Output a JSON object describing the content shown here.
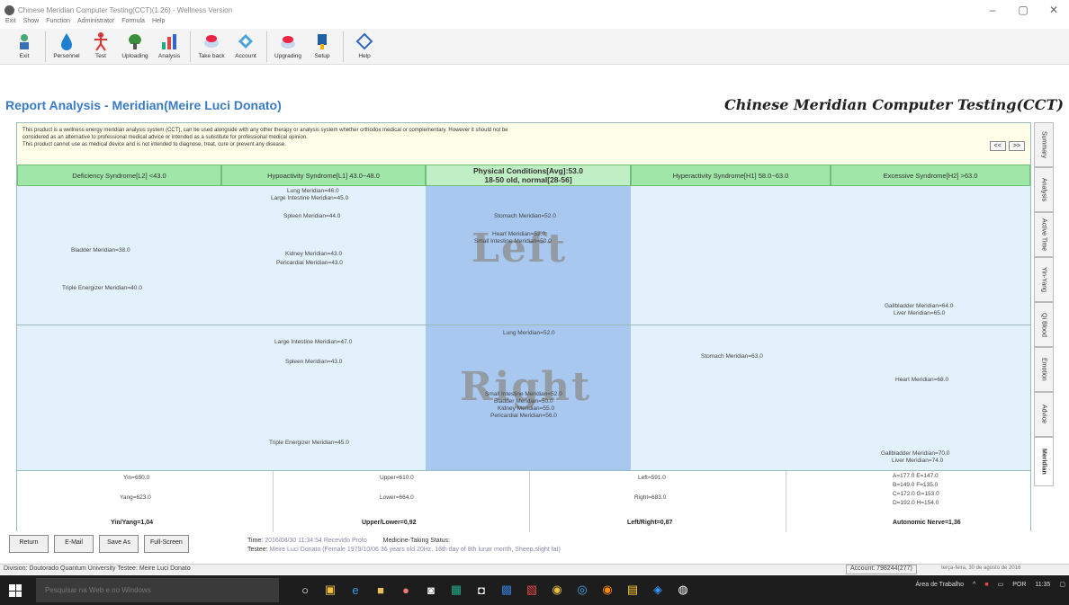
{
  "window": {
    "title": "Chinese Meridian Computer Testing(CCT)(1.26) - Wellness Version"
  },
  "menu": [
    "Exit",
    "Show",
    "Function",
    "Administrator",
    "Formula",
    "Help"
  ],
  "toolbar": [
    {
      "label": "Exit",
      "icon": "exit-icon"
    },
    {
      "label": "Personnel",
      "icon": "person-drop-icon"
    },
    {
      "label": "Test",
      "icon": "test-figure-icon"
    },
    {
      "label": "Uploading",
      "icon": "upload-icon"
    },
    {
      "label": "Analysis",
      "icon": "analysis-chart-icon"
    },
    {
      "label": "Take back",
      "icon": "takeback-icon"
    },
    {
      "label": "Account",
      "icon": "account-icon"
    },
    {
      "label": "Upgrading",
      "icon": "upgrade-icon"
    },
    {
      "label": "Setup",
      "icon": "setup-icon"
    },
    {
      "label": "Help",
      "icon": "help-icon"
    }
  ],
  "report": {
    "title": "Report Analysis - Meridian(Meire Luci Donato)",
    "brand": "Chinese Meridian Computer Testing(CCT)"
  },
  "notice": {
    "line1": "This product is a wellness energy meridian analysis system (CCT), can be used alongside with any other therapy or analysis system whether orthodox medical or complementary. However it should not be",
    "line2": "considered as an alternative to professional medical advice or intended as a substitute for professional medical opinion.",
    "line3": "This product cannot use as medical device and is not intended to diagnose, treat, cure or prevent any disease.",
    "prev": "<<",
    "next": ">>"
  },
  "headers": {
    "l2": "Deficiency Syndrome[L2] <43.0",
    "l1": "Hypoactivity Syndrome[L1] 43.0~48.0",
    "center_line1": "Physical Conditions[Avg]:53.0",
    "center_line2": "18-50 old, normal[28-56]",
    "h1": "Hyperactivity Syndrome[H1] 58.0~63.0",
    "h2": "Excessive Syndrome[H2] >63.0"
  },
  "left": {
    "label": "Left",
    "l2": [
      "Bladder Meridian=38.0",
      "Triple Energizer Meridian=40.0"
    ],
    "l1": [
      "Lung Meridian=46.0",
      "Large Intestine Meridian=45.0",
      "Spleen Meridian=44.0",
      "Kidney Meridian=43.0",
      "Pericardial Meridian=43.0"
    ],
    "center": [
      "Stomach Meridian=52.0",
      "Heart Meridian=52.0",
      "Small Intestine Meridian=50.0"
    ],
    "h2": [
      "Gallbladder Meridian=64.0",
      "Liver Meridian=65.0"
    ]
  },
  "right": {
    "label": "Right",
    "l1": [
      "Large Intestine Meridian=47.0",
      "Spleen Meridian=43.0",
      "Triple Energizer Meridian=45.0"
    ],
    "center": [
      "Lung Meridian=52.0",
      "Small Intestine Meridian=52.0",
      "Bladder Meridian=50.0",
      "Kidney Meridian=55.0",
      "Pericardial Meridian=56.0"
    ],
    "h1": [
      "Stomach Meridian=63.0"
    ],
    "h2": [
      "Heart Meridian=68.0",
      "Gallbladder Meridian=70.0",
      "Liver Meridian=74.0"
    ]
  },
  "summary": {
    "yin": "Yin=650.0",
    "yang": "Yang=623.0",
    "yinyang": "Yin/Yang=1,04",
    "upper": "Upper=610.0",
    "lower": "Lower=664.0",
    "upperlower": "Upper/Lower=0,92",
    "leftv": "Left=591.0",
    "rightv": "Right=683.0",
    "leftright": "Left/Right=0,87",
    "auto1": "A=177.0  E=147.0",
    "auto2": "B=149.0  F=135.0",
    "auto3": "C=172.0  G=153.0",
    "auto4": "D=192.0  H=154.0",
    "autonomic": "Autonomic Nerve=1,36"
  },
  "sidetabs": [
    "Summary",
    "Analysis",
    "Active Time",
    "Yin-Yang",
    "Qi Blood",
    "Emotion",
    "Advice",
    "Meridian"
  ],
  "bottom": {
    "buttons": [
      "Return",
      "E-Mail",
      "Save As",
      "Full-Screen"
    ],
    "time_label": "Time:",
    "time_value": "2016/08/30 11:34:54 Recevido Proto",
    "medicine_label": "Medicine-Taking Status:",
    "tester_label": "Testee:",
    "tester_value": "Meire Luci Donato (Female 1979/10/06 36 years old 20Hz, 16th day of 8th lunar month, Sheep,slight fat)"
  },
  "status": {
    "left": "Division: Doutorado Quantum University   Testee: Meire Luci Donato",
    "account": "Account: 798244(277)",
    "datetime": "terça-feira, 30 de agosto de 2016"
  },
  "taskbar": {
    "search": "Pesquisar na Web e no Windows",
    "tray_text": "Área de Trabalho",
    "lang": "POR",
    "clock": "11:35"
  }
}
